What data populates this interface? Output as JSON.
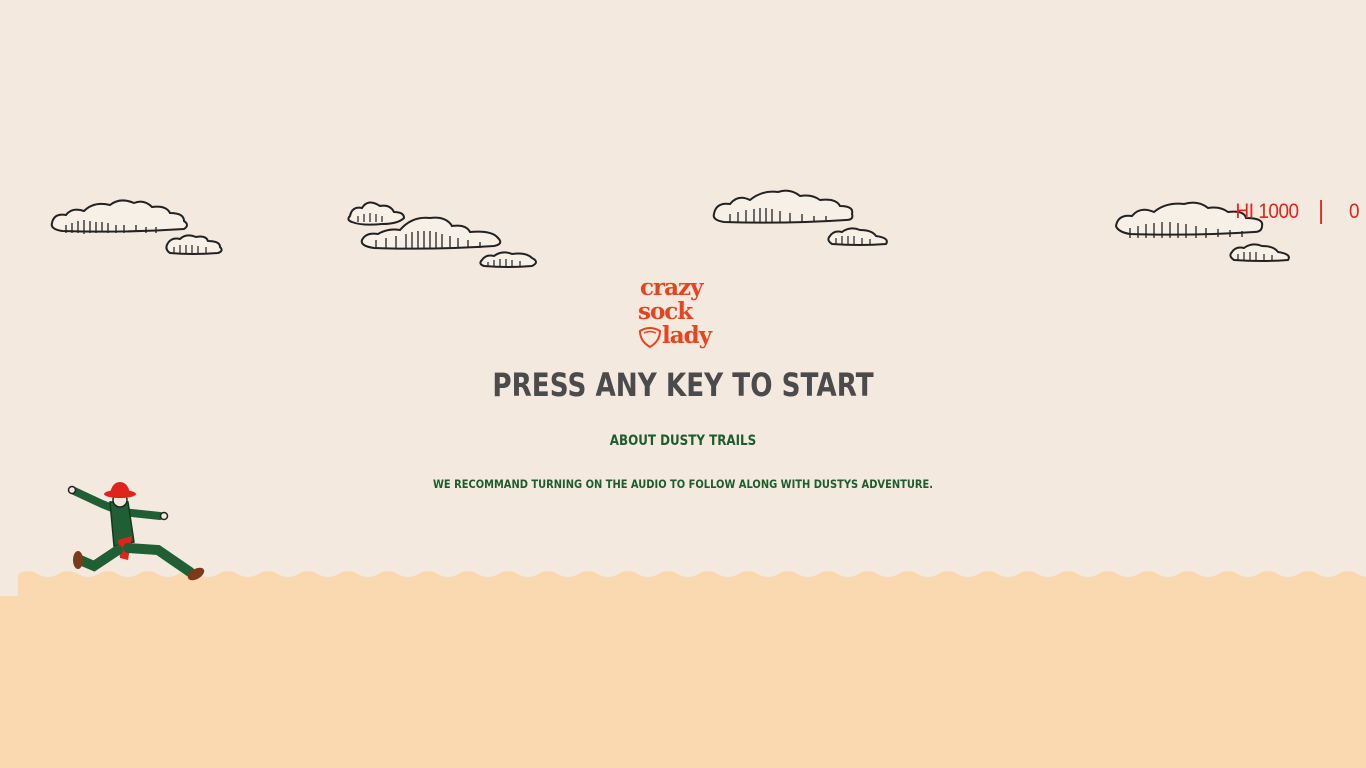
{
  "game": {
    "title_logo": [
      "crazy",
      "sock",
      "lady"
    ],
    "prompt": "PRESS ANY KEY TO START",
    "about_link": "ABOUT DUSTY TRAILS",
    "audio_note": "WE RECOMMAND TURNING ON THE AUDIO TO FOLLOW ALONG WITH DUSTYS ADVENTURE."
  },
  "score": {
    "hi_label": "HI",
    "hi_value": "1000",
    "current": "0"
  },
  "colors": {
    "sky": "#f3e9de",
    "ground": "#fbd9b0",
    "accent_red": "#e0231b",
    "text_green": "#1d5c2c",
    "text_gray": "#4b4b4b"
  },
  "icons": [
    "cloud-icon",
    "runner-character",
    "sock-shield-icon"
  ]
}
